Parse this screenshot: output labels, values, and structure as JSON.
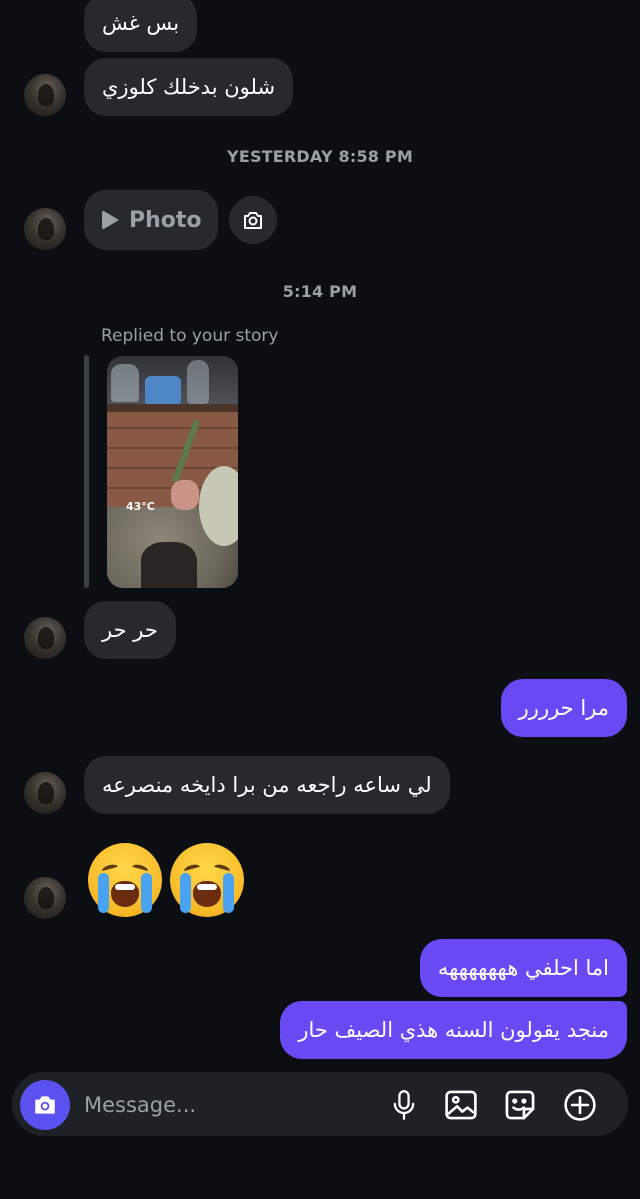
{
  "messages": {
    "m1": "بس غش",
    "m2": "شلون بدخلك كلوزي",
    "m3": "حر حر",
    "m4": "مرا حرررر",
    "m5": "لي ساعه راجعه من برا دايخه منصرعه",
    "m6": "اما احلفي هههههههه",
    "m7": "منجد يقولون السنه هذي الصيف حار"
  },
  "timestamps": {
    "yesterday": "YESTERDAY 8:58 PM",
    "today": "5:14 PM"
  },
  "photo_pill": {
    "label": "Photo",
    "icon": "play-icon"
  },
  "story_reply": {
    "label": "Replied to your story",
    "temperature": "43°C"
  },
  "emojis": [
    "loudly-crying-face",
    "loudly-crying-face"
  ],
  "composer": {
    "placeholder": "Message...",
    "camera_icon": "camera-icon",
    "tools": [
      "microphone-icon",
      "gallery-icon",
      "sticker-icon",
      "plus-icon"
    ]
  },
  "colors": {
    "background": "#0b0f14",
    "incoming_bubble": "#262a2f",
    "outgoing_bubble": "#6a49f5",
    "camera_button": "#5b51f0"
  }
}
